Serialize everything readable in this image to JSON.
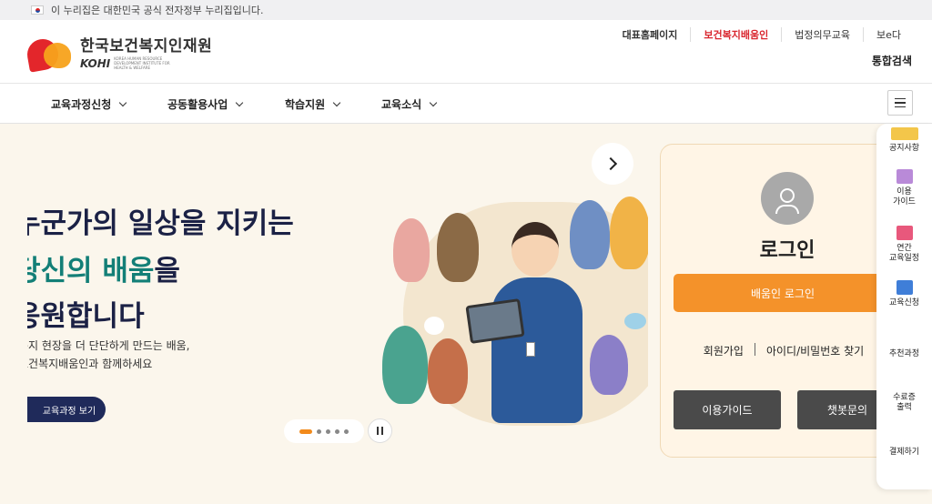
{
  "gov_banner": {
    "text": "이 누리집은 대한민국 공식 전자정부 누리집입니다."
  },
  "logo": {
    "korean": "한국보건복지인재원",
    "english": "KOHI",
    "sub": "KOREA HUMAN RESOURCE DEVELOPMENT INSTITUTE FOR HEALTH & WELFARE"
  },
  "util_nav": [
    {
      "label": "대표홈페이지"
    },
    {
      "label": "보건복지배움인"
    },
    {
      "label": "법정의무교육"
    },
    {
      "label": "보e다"
    }
  ],
  "search_link": "통합검색",
  "gnb": [
    {
      "label": "교육과정신청"
    },
    {
      "label": "공동활용사업"
    },
    {
      "label": "학습지원"
    },
    {
      "label": "교육소식"
    }
  ],
  "hero": {
    "line1": "누군가의 일상을 지키는",
    "line2_teal": "당신의 배움",
    "line2_rest": "을",
    "line3": "응원합니다",
    "desc1": "복지 현장을 더 단단하게 만드는 배움,",
    "desc2": "보건복지배움인과 함께하세요",
    "cta": "교육과정 보기"
  },
  "slider": {
    "active_index": 0,
    "count": 5
  },
  "login": {
    "title": "로그인",
    "login_button": "배움인 로그인",
    "signup": "회원가입",
    "find": "아이디/비밀번호 찾기",
    "guide": "이용가이드",
    "chatbot": "챗봇문의"
  },
  "quick_menu": [
    {
      "label": "공지사항",
      "icon": "notice-icon",
      "color": "#f3c64a"
    },
    {
      "label": "이용\n가이드",
      "icon": "guide-icon",
      "color": "#b98ad8"
    },
    {
      "label": "연간\n교육일정",
      "icon": "calendar-icon",
      "color": "#e8587c"
    },
    {
      "label": "교육신청",
      "icon": "apply-icon",
      "color": "#3f7ed8"
    },
    {
      "label": "추천과정",
      "icon": "",
      "color": ""
    },
    {
      "label": "수료증\n출력",
      "icon": "",
      "color": ""
    },
    {
      "label": "결제하기",
      "icon": "",
      "color": ""
    }
  ],
  "colors": {
    "accent_orange": "#f4922a",
    "brand_red": "#d9262e",
    "navy": "#1f2a5a",
    "teal": "#137f77"
  }
}
